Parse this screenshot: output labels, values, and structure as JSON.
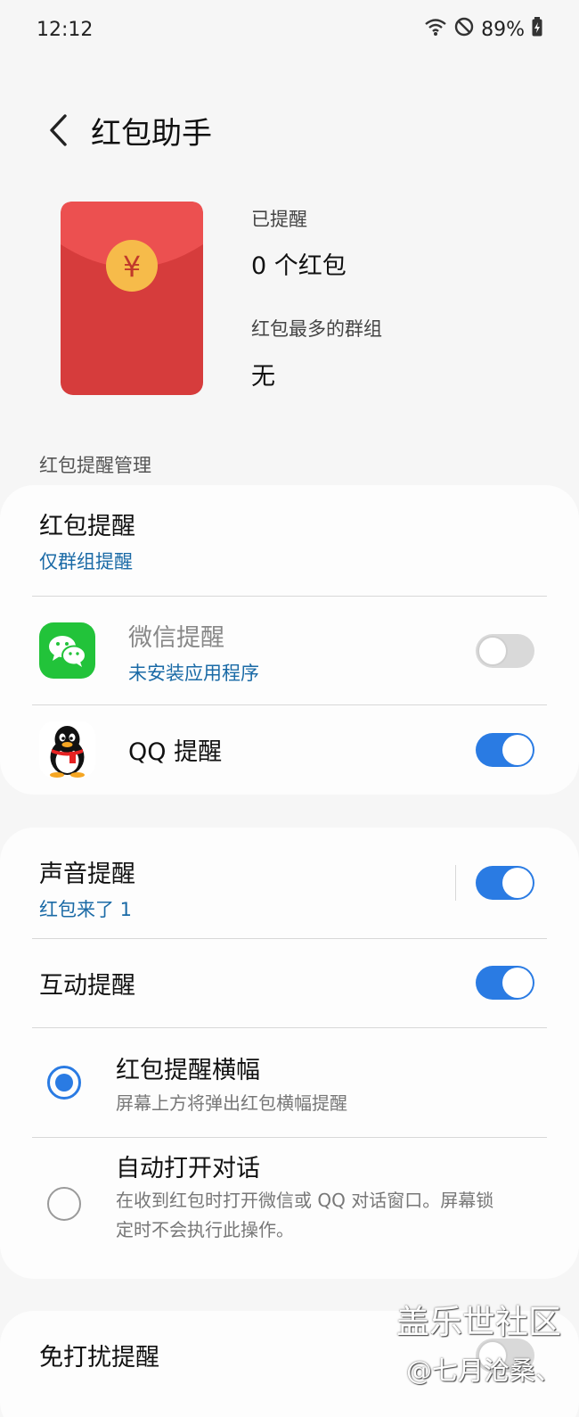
{
  "status_bar": {
    "time": "12:12",
    "battery": "89%"
  },
  "header": {
    "title": "红包助手"
  },
  "summary": {
    "reminded_label": "已提醒",
    "reminded_value": "0 个红包",
    "top_group_label": "红包最多的群组",
    "top_group_value": "无"
  },
  "section_title": "红包提醒管理",
  "reminder_card": {
    "main": {
      "title": "红包提醒",
      "sub": "仅群组提醒"
    },
    "wechat": {
      "title": "微信提醒",
      "sub": "未安装应用程序",
      "enabled": false
    },
    "qq": {
      "title": "QQ 提醒",
      "enabled": true
    }
  },
  "sound_card": {
    "sound": {
      "title": "声音提醒",
      "sub": "红包来了 1",
      "enabled": true
    },
    "interactive": {
      "title": "互动提醒",
      "enabled": true
    },
    "banner": {
      "title": "红包提醒横幅",
      "desc": "屏幕上方将弹出红包横幅提醒",
      "selected": true
    },
    "auto_open": {
      "title": "自动打开对话",
      "desc_line1": "在收到红包时打开微信或 QQ 对话窗口。屏幕锁",
      "desc_line2": "定时不会执行此操作。",
      "selected": false
    }
  },
  "dnd_card": {
    "title": "免打扰提醒",
    "enabled": false
  },
  "watermark": {
    "line1": "盖乐世社区",
    "line2": "@七月沧桑、"
  },
  "colors": {
    "accent": "#2a7be3",
    "link": "#1a6aa6",
    "envelope": "#d94040",
    "coin": "#f4b740"
  }
}
